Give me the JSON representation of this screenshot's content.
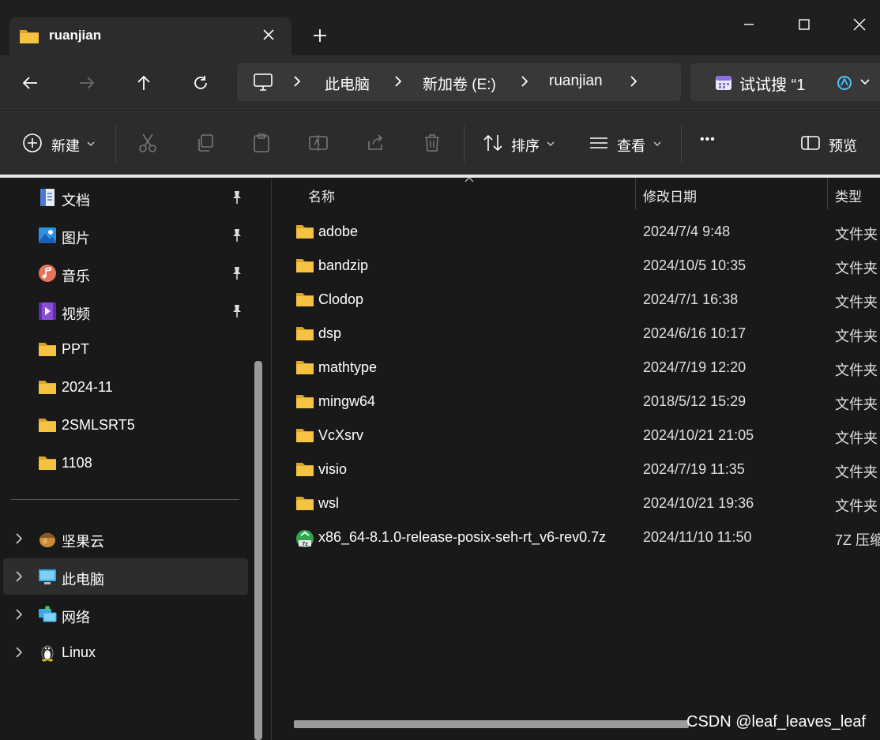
{
  "tab": {
    "title": "ruanjian"
  },
  "address": {
    "crumbs": [
      "此电脑",
      "新加卷 (E:)",
      "ruanjian"
    ]
  },
  "search": {
    "placeholder": "试试搜 “1"
  },
  "toolbar": {
    "new_label": "新建",
    "sort_label": "排序",
    "view_label": "查看",
    "more_label": "•••",
    "preview_label": "预览"
  },
  "sidebar": {
    "pinned": [
      {
        "label": "文档",
        "icon": "document-icon"
      },
      {
        "label": "图片",
        "icon": "picture-icon"
      },
      {
        "label": "音乐",
        "icon": "music-icon"
      },
      {
        "label": "视频",
        "icon": "video-icon"
      }
    ],
    "folders": [
      {
        "label": "PPT"
      },
      {
        "label": "2024-11"
      },
      {
        "label": "2SMLSRT5"
      },
      {
        "label": "1108"
      }
    ],
    "locations": [
      {
        "label": "坚果云",
        "icon": "nut-cloud-icon"
      },
      {
        "label": "此电脑",
        "icon": "computer-icon",
        "selected": true
      },
      {
        "label": "网络",
        "icon": "network-icon"
      },
      {
        "label": "Linux",
        "icon": "linux-penguin-icon"
      }
    ]
  },
  "columns": {
    "name": "名称",
    "date": "修改日期",
    "type": "类型"
  },
  "files": [
    {
      "name": "adobe",
      "date": "2024/7/4 9:48",
      "type": "文件夹",
      "kind": "folder"
    },
    {
      "name": "bandzip",
      "date": "2024/10/5 10:35",
      "type": "文件夹",
      "kind": "folder"
    },
    {
      "name": "Clodop",
      "date": "2024/7/1 16:38",
      "type": "文件夹",
      "kind": "folder"
    },
    {
      "name": "dsp",
      "date": "2024/6/16 10:17",
      "type": "文件夹",
      "kind": "folder"
    },
    {
      "name": "mathtype",
      "date": "2024/7/19 12:20",
      "type": "文件夹",
      "kind": "folder"
    },
    {
      "name": "mingw64",
      "date": "2018/5/12 15:29",
      "type": "文件夹",
      "kind": "folder"
    },
    {
      "name": "VcXsrv",
      "date": "2024/10/21 21:05",
      "type": "文件夹",
      "kind": "folder"
    },
    {
      "name": "visio",
      "date": "2024/7/19 11:35",
      "type": "文件夹",
      "kind": "folder"
    },
    {
      "name": "wsl",
      "date": "2024/10/21 19:36",
      "type": "文件夹",
      "kind": "folder"
    },
    {
      "name": "x86_64-8.1.0-release-posix-seh-rt_v6-rev0.7z",
      "date": "2024/11/10 11:50",
      "type": "7Z 压缩",
      "kind": "archive"
    }
  ],
  "watermark": "CSDN @leaf_leaves_leaf",
  "colors": {
    "folder": "#f5c242",
    "folder_dark": "#d9a52c",
    "accent": "#4cc2ff"
  }
}
